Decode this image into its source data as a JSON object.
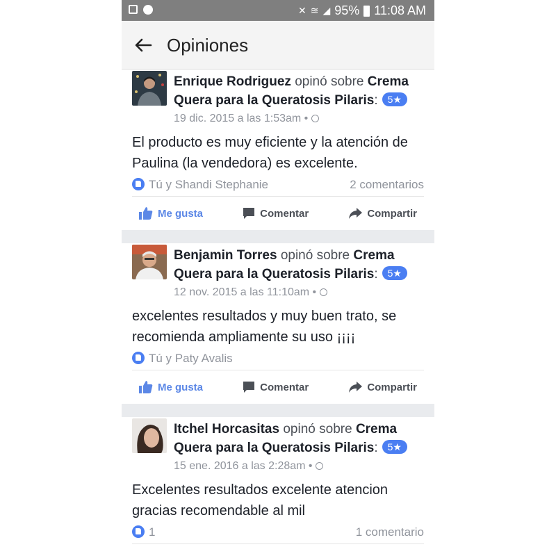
{
  "status_bar": {
    "battery": "95%",
    "time": "11:08 AM"
  },
  "app_bar": {
    "title": "Opiniones"
  },
  "posts": [
    {
      "author": "Enrique Rodriguez",
      "verb": "opinó sobre",
      "product": "Crema Quera para la Queratosis Pilaris",
      "rating": "5★",
      "timestamp": "19 dic. 2015 a las 1:53am",
      "text": "El producto es muy eficiente y la atención de Paulina (la vendedora) es excelente.",
      "likes": "Tú y Shandi Stephanie",
      "comments": "2 comentarios"
    },
    {
      "author": "Benjamin Torres",
      "verb": "opinó sobre",
      "product": "Crema Quera para la Queratosis Pilaris",
      "rating": "5★",
      "timestamp": "12 nov. 2015 a las 11:10am",
      "text": "excelentes resultados y muy buen trato, se recomienda ampliamente su uso ¡¡¡¡",
      "likes": "Tú y Paty Avalis",
      "comments": ""
    },
    {
      "author": "Itchel Horcasitas",
      "verb": "opinó sobre",
      "product": "Crema Quera para la Queratosis Pilaris",
      "rating": "5★",
      "timestamp": "15 ene. 2016 a las 2:28am",
      "text": "Excelentes resultados excelente atencion gracias recomendable al mil",
      "likes": "1",
      "comments": "1 comentario"
    }
  ],
  "actions": {
    "like": "Me gusta",
    "comment": "Comentar",
    "share": "Compartir"
  },
  "colors": {
    "accent": "#4a7ef2",
    "status_bar": "#7f7f7f",
    "separator": "#e9ebee"
  }
}
